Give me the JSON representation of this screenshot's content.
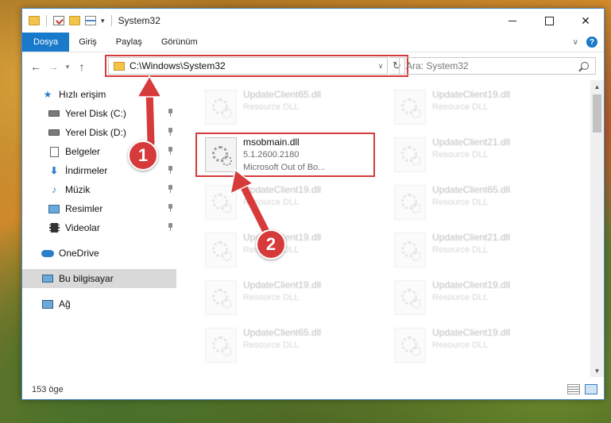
{
  "window": {
    "title": "System32",
    "controls": {
      "close": "✕"
    }
  },
  "ribbon": {
    "tabs": [
      "Dosya",
      "Giriş",
      "Paylaş",
      "Görünüm"
    ],
    "help": "?"
  },
  "nav": {
    "back": "←",
    "forward": "→",
    "recent": "▾",
    "up": "↑",
    "address": "C:\\Windows\\System32",
    "refresh": "↻",
    "search_placeholder": "Ara: System32"
  },
  "sidebar": {
    "items": [
      {
        "label": "Hızlı erişim",
        "icon": "star-icon"
      },
      {
        "label": "Yerel Disk (C:)",
        "icon": "drive-icon",
        "pinned": true
      },
      {
        "label": "Yerel Disk (D:)",
        "icon": "drive-icon",
        "pinned": true
      },
      {
        "label": "Belgeler",
        "icon": "documents-icon",
        "pinned": true
      },
      {
        "label": "İndirmeler",
        "icon": "downloads-icon",
        "pinned": true
      },
      {
        "label": "Müzik",
        "icon": "music-icon",
        "pinned": true
      },
      {
        "label": "Resimler",
        "icon": "pictures-icon",
        "pinned": true
      },
      {
        "label": "Videolar",
        "icon": "videos-icon",
        "pinned": true
      },
      {
        "label": "OneDrive",
        "icon": "onedrive-icon"
      },
      {
        "label": "Bu bilgisayar",
        "icon": "computer-icon",
        "selected": true
      },
      {
        "label": "Ağ",
        "icon": "network-icon"
      }
    ]
  },
  "files": [
    {
      "name": "UpdateClient65.dll",
      "type": "Resource DLL"
    },
    {
      "name": "UpdateClient19.dll",
      "type": "Resource DLL"
    },
    {
      "name": "msobmain.dll",
      "version": "5.1.2600.2180",
      "description": "Microsoft Out of Bo..."
    },
    {
      "name": "UpdateClient21.dll",
      "type": "Resource DLL"
    },
    {
      "name": "UpdateClient19.dll",
      "type": "Resource DLL"
    },
    {
      "name": "UpdateClient65.dll",
      "type": "Resource DLL"
    },
    {
      "name": "UpdateClient19.dll",
      "type": "Resource DLL"
    },
    {
      "name": "UpdateClient21.dll",
      "type": "Resource DLL"
    },
    {
      "name": "UpdateClient19.dll",
      "type": "Resource DLL"
    },
    {
      "name": "UpdateClient19.dll",
      "type": "Resource DLL"
    },
    {
      "name": "UpdateClient65.dll",
      "type": "Resource DLL"
    },
    {
      "name": "UpdateClient19.dll",
      "type": "Resource DLL"
    }
  ],
  "status": {
    "count": "153 öge"
  },
  "annotations": {
    "badge1": "1",
    "badge2": "2",
    "highlight_color": "#d63a3a"
  },
  "colors": {
    "accent": "#1979ca",
    "highlight": "#d63a3a"
  }
}
